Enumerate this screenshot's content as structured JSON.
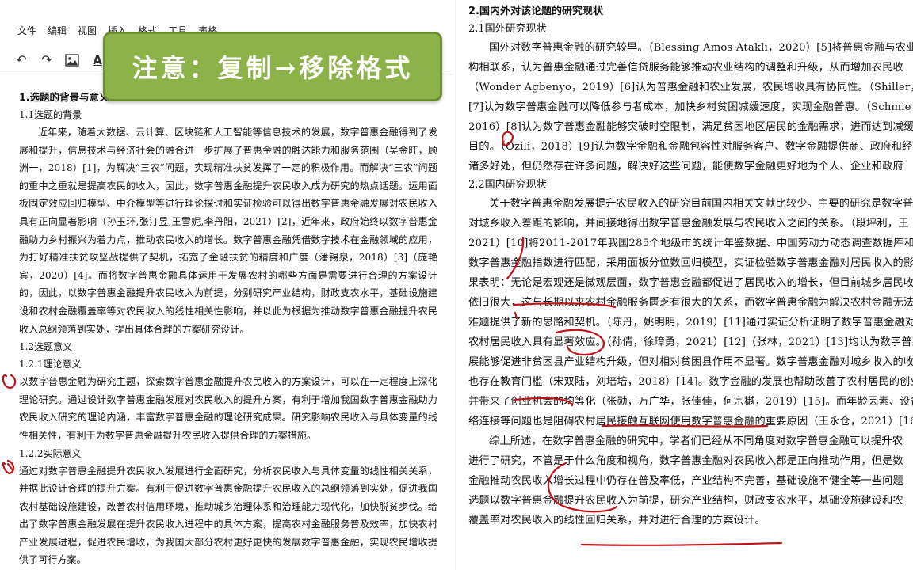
{
  "menu": {
    "items": [
      "文件",
      "编辑",
      "视图",
      "插入",
      "格式",
      "工具",
      "表格"
    ]
  },
  "toolbar": {
    "undo_icon": "undo-icon",
    "redo_icon": "redo-icon",
    "image_icon": "image-icon",
    "font_color_label": "A",
    "dropdown_icon": "chevron-down-icon"
  },
  "banner": {
    "text": "注意：复制→移除格式",
    "color": "#8bb34a"
  },
  "left_doc": {
    "h1": "1.选题的背景与意义",
    "h1_1": "1.1选题的背景",
    "p1": "近年来，随着大数据、云计算、区块链和人工智能等信息技术的发展，数字普惠金融得到了发展和提升，信息技术与经济社会的融合进一步扩展了普惠金融的触达能力和服务范围（吴金旺，顾洲一，2018）[1]，为解决“三农”问题，实现精准扶贫发挥了一定的积极作用。而解决“三农”问题的重中之重就是提高农民的收入，因此，数字普惠金融提升农民收入成为研究的热点话题。运用面板固定效应回归模型、中介模型等进行理论探讨和实证检验可以得出数字普惠金融发展对农民收入具有正向显著影响（孙玉环,张汀昱,王雪妮,李丹阳，2021）[2]，近年来，政府始终以数字普惠金融助力乡村振兴为着力点，推动农民收入的增长。数字普惠金融凭借数字技术在金融领域的应用，为打好精准扶贫攻坚战提供了契机，拓宽了金融扶贫的精度和广度（潘锡泉，2018）[3]（庞艳宾，2020）[4]。而将数字普惠金融具体运用于发展农村的哪些方面是需要进行合理的方案设计的，因此，以数字普惠金融提升农民收入为前提，分别研究产业结构，财政支农水平，基础设施建设和农村金融覆盖率等对农民收入的线性相关性影响，并以此为根据为推动数字普惠金融提升农民收入总纲领落到实处，提出具体合理的方案研究设计。",
    "h1_2": "1.2选题意义",
    "h1_2_1": "1.2.1理论意义",
    "p2": "以数字普惠金融为研究主题，探索数字普惠金融提升农民收入的方案设计，可以在一定程度上深化理论研究。通过设计数字普惠金融发展对农民收入的提升方案，有利于增加我国数字普惠金融助力农民收入研究的理论内涵，丰富数字普惠金融的理论研究成果。研究影响农民收入与具体变量的线性相关性，有利于为数字普惠金融提升农民收入提供合理的方案措施。",
    "h1_2_2": "1.2.2实际意义",
    "p3": "通过对数字普惠金融提升农民收入发展进行全面研究，分析农民收入与具体变量的线性相关关系，并据此设计合理的提升方案。有利于促进数字普惠金融提升农民收入的总纲领落到实处，促进我国农村基础设施建设，改善农村信用环境，推动城乡治理体系和治理能力现代化，加快脱贫步伐。给出了数字普惠金融发展在提升农民收入进程中的具体方案，提高农村金融服务普及效率，加快农村产业发展进程，促进农民增收，为我国大部分农村更好更快的发展数字普惠金融，实现农民增收提供了可行方案。"
  },
  "right_doc": {
    "h1": "2.国内外对该论题的研究现状",
    "h2_1": "2.1国外研究现状",
    "lines_a": [
      "国外对数字普惠金融的研究较早。（Blessing Amos Atakli，2020）[5]将普惠金融与农业成",
      "构相联系，认为普惠金融通过完善信贷服务能够推动农业结构的调整和升级，从而增加农民收",
      "（Wonder Agbenyo，2019）[6]认为普惠金融和农业发展，农民增收具有协同性。（Shiller，20",
      "[7]认为数字普惠金融可以降低参与者成本，加快乡村贫困减缓速度，实现金融普惠。（Schmie",
      "2016）[8]认为数字普惠金融能够突破时空限制，满足贫困地区居民的金融需求，进而达到减缓",
      "目的。（Ozili，2018）[9]认为数字金融和金融包容性对服务客户、数字金融提供商、政府和经",
      "诸多好处，但仍然存在许多问题，解决好这些问题，能使数字金融更好地为个人、企业和政府"
    ],
    "h2_2": "2.2国内研究现状",
    "lines_b": [
      "关于数字普惠金融发展提升农民收入的研究目前国内相关文献比较少。主要的研究是数字普",
      "对城乡收入差距的影响，并间接地得出数字普惠金融发展与农民收入之间的关系。（段坪利，王",
      "2021）[10]将2011-2017年我国285个地级市的统计年鉴数据、中国劳动力动态调查数据库和北京",
      "数字普惠金融指数进行匹配，采用面板分位数回归模型，实证检验数字普惠金融对居民收入的影",
      "果表明：无论是宏观还是微观层面，数字普惠金融都促进了居民收入的增长，但目前城乡居民收",
      "依旧很大，这与长期以来农村金融服务匮乏有很大的关系，而数字普惠金融为解决农村金融无法",
      "难题提供了新的思路和契机。（陈丹，姚明明，2019）[11]通过实证分析证明了数字普惠金融对",
      "农村居民收入具有显著效应。（孙倩，徐璋勇，2021）[12]（张林，2021）[13]均认为数字普惠",
      "展能够促进非贫困县产业结构升级，但对相对贫困县作用不显著。数字普惠金融对城乡收入的收",
      "也存在教育门槛（宋双陆，刘培培，2018）[14]。数字金融的发展也帮助改善了农村居民的创业",
      "并带来了创业机会的均等化（张勋，万广华，张佳佳，何宗樾，2019）[15]。而年龄因素、设备不",
      "络连接等问题也是阻碍农村居民接触互联网使用数字普惠金融的重要原因（王永仓，2021）[16"
    ],
    "lines_c": [
      "综上所述，在数字普惠金融的研究中，学者们已经从不同角度对数字普惠金融可以提升农",
      "进行了研究，不管是于什么角度和视角，数字普惠金融对农民收入都是正向推动作用，但是数",
      "金融推动农民收入增长过程中仍存在普及率低，产业结构不完善，基础设施不健全等一些问题",
      "选题以数字普惠金融提升农民收入为前提，研究产业结构，财政支农水平，基础设施建设和农",
      "覆盖率对农民收入的线性回归关系，并对进行合理的方案设计。"
    ]
  },
  "annotation_color": "#c0121a"
}
